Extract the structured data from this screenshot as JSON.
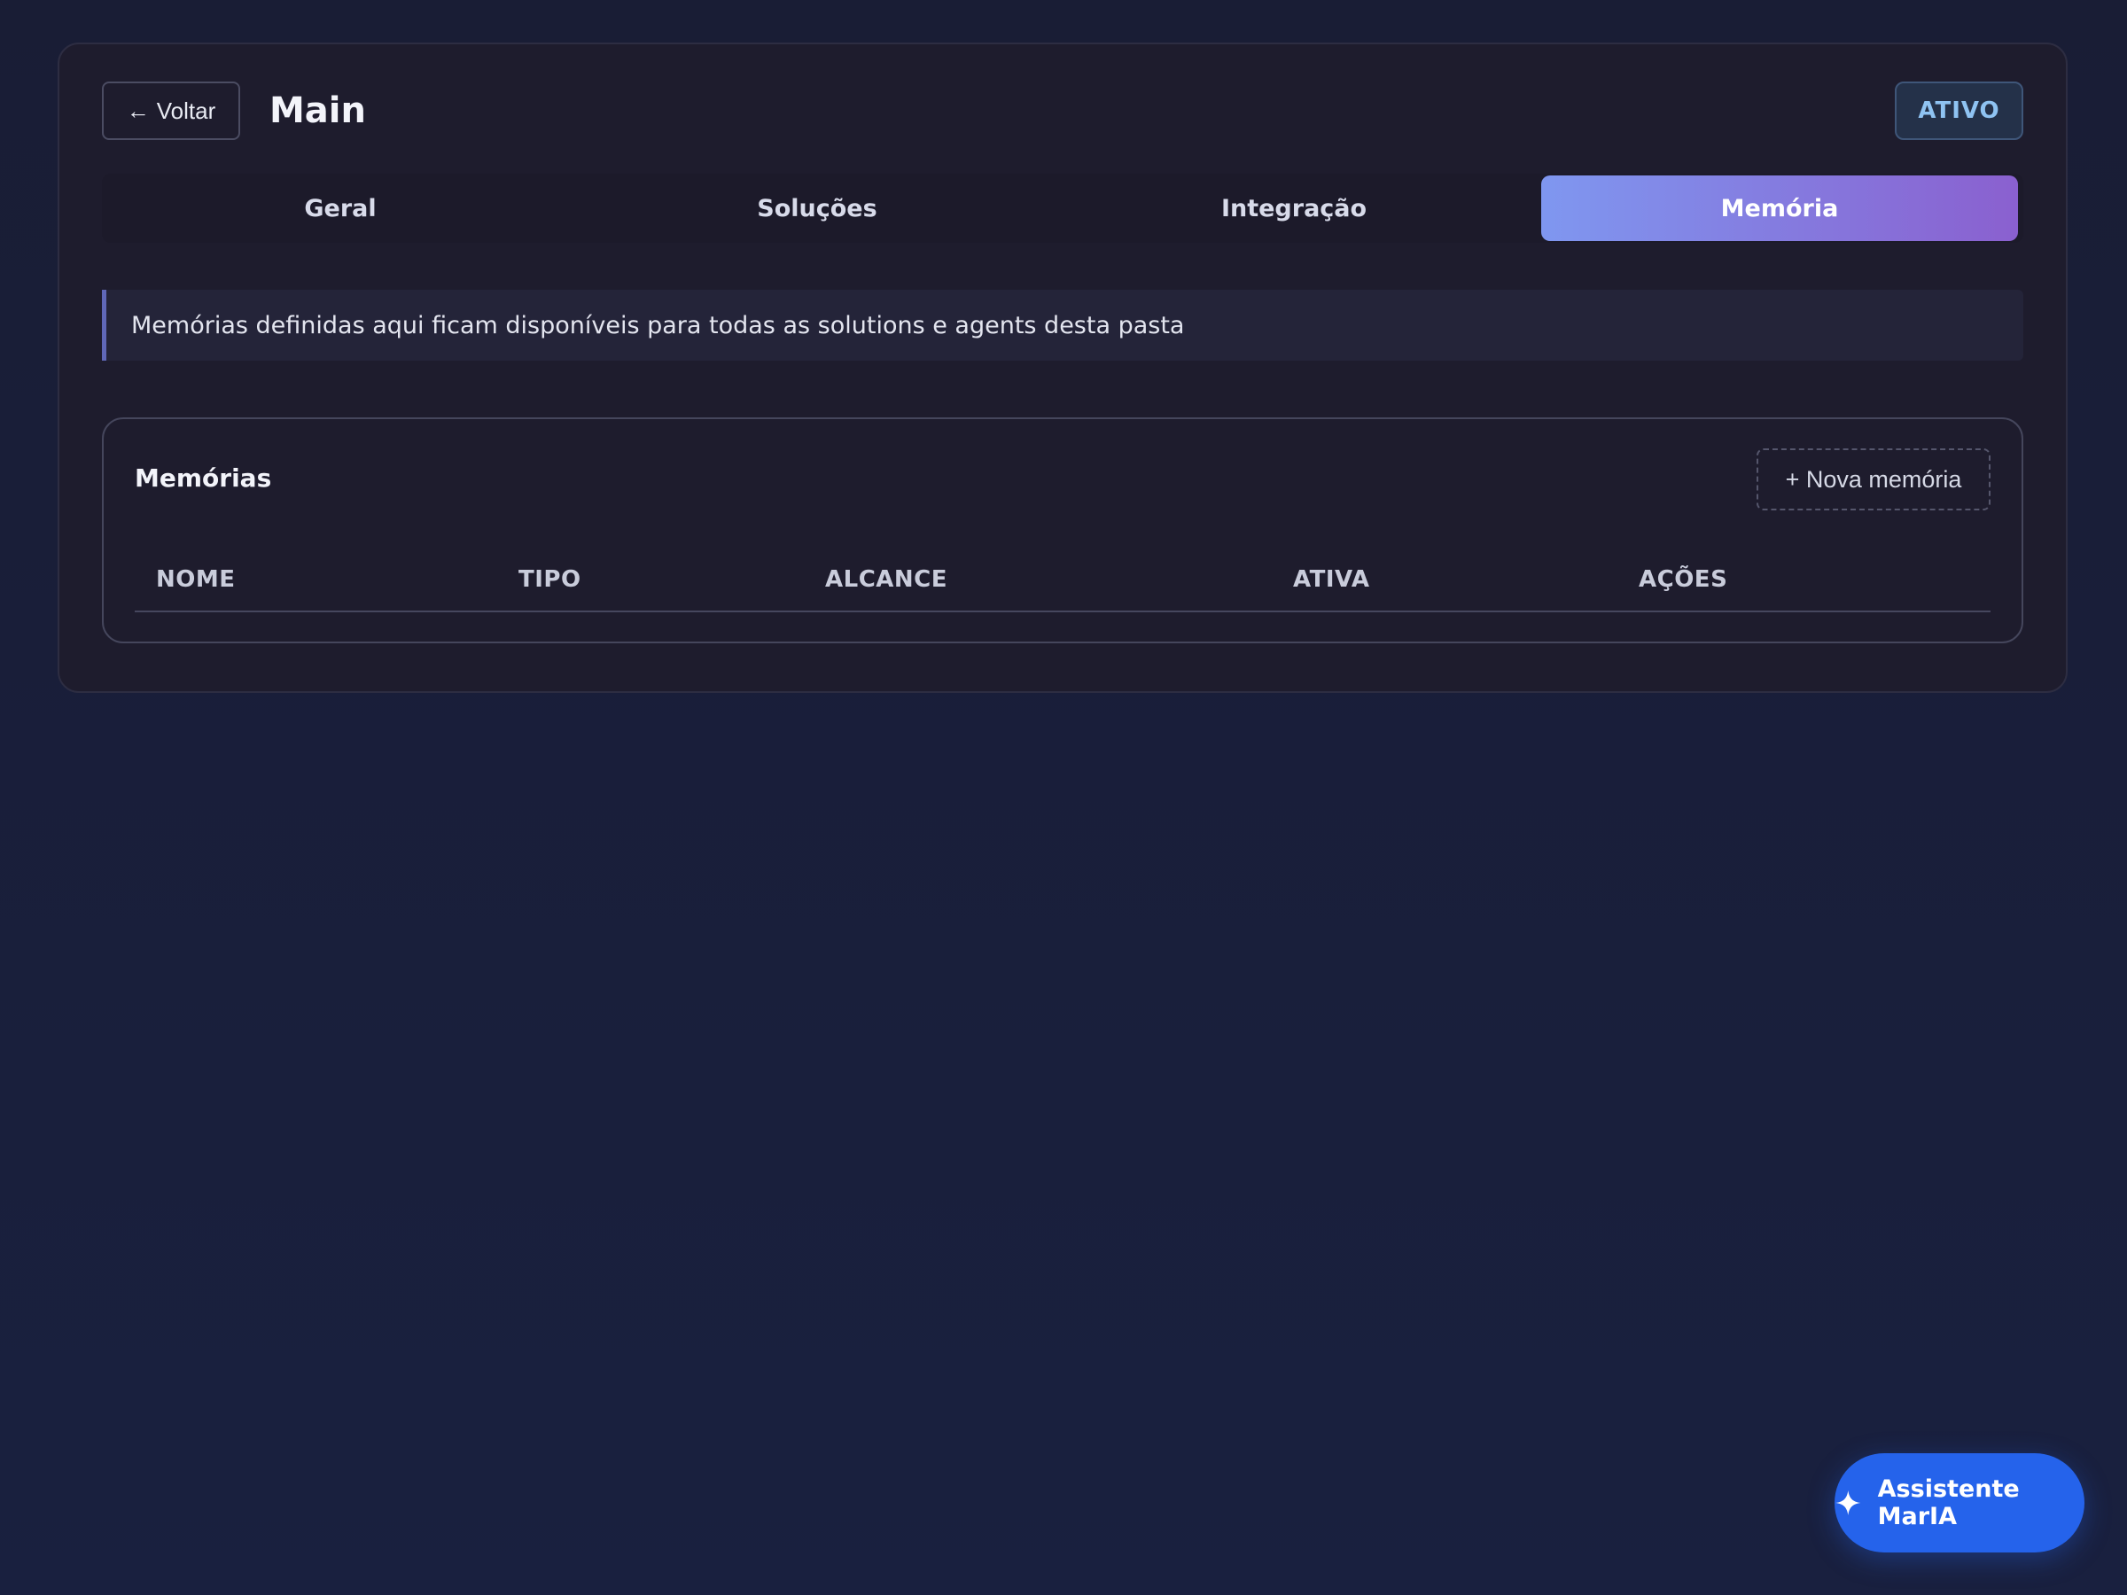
{
  "header": {
    "back_label": "Voltar",
    "back_arrow": "←",
    "title": "Main",
    "status": "ATIVO"
  },
  "tabs": [
    {
      "label": "Geral",
      "active": false
    },
    {
      "label": "Soluções",
      "active": false
    },
    {
      "label": "Integração",
      "active": false
    },
    {
      "label": "Memória",
      "active": true
    }
  ],
  "info_banner": {
    "text": "Memórias definidas aqui ficam disponíveis para todas as solutions e agents desta pasta"
  },
  "memories": {
    "title": "Memórias",
    "new_button_label": "+ Nova memória",
    "columns": [
      "NOME",
      "TIPO",
      "ALCANCE",
      "ATIVA",
      "AÇÕES"
    ],
    "rows": []
  },
  "assistant": {
    "label": "Assistente MarIA",
    "icon": "sparkle-icon"
  },
  "colors": {
    "accent_gradient_start": "#7f97f0",
    "accent_gradient_end": "#8a60cf",
    "assistant_blue": "#2563eb",
    "status_text": "#8fc3f2"
  }
}
